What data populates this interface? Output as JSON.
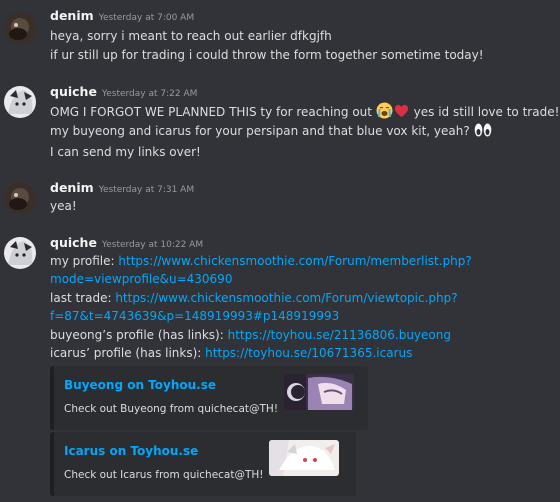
{
  "messages": [
    {
      "author": "denim",
      "timestamp": "Yesterday at 7:00 AM",
      "lines": [
        "heya, sorry i meant to reach out earlier dfkgjfh",
        "if ur still up for trading i could throw the form together sometime today!"
      ]
    },
    {
      "author": "quiche",
      "timestamp": "Yesterday at 7:22 AM",
      "line1_a": "OMG I FORGOT WE PLANNED THIS ty for reaching out",
      "line1_b": "yes id still love to trade!!",
      "line2": "my buyeong and icarus for your persipan and that blue vox kit, yeah?",
      "line3": "I can send my links over!",
      "emojis": [
        "loudly-crying-face",
        "red-heart",
        "eyes"
      ]
    },
    {
      "author": "denim",
      "timestamp": "Yesterday at 7:31 AM",
      "lines": [
        "yea!"
      ]
    },
    {
      "author": "quiche",
      "timestamp": "Yesterday at 10:22 AM",
      "profile_label": "my profile:",
      "profile_link_1": "https://www.chickensmoothie.com/Forum/memberlist.php?",
      "profile_link_2": "mode=viewprofile&u=430690",
      "trade_label": "last trade:",
      "trade_link_1": "https://www.chickensmoothie.com/Forum/viewtopic.php?",
      "trade_link_2": "f=87&t=4743639&p=148919993#p148919993",
      "buyeong_label": "buyeong’s profile (has links):",
      "buyeong_link": "https://toyhou.se/21136806.buyeong",
      "icarus_label": "icarus’ profile (has links):",
      "icarus_link": "https://toyhou.se/10671365.icarus",
      "embeds": [
        {
          "title": "Buyeong on Toyhou.se",
          "description": "Check out Buyeong from quichecat@TH!"
        },
        {
          "title": "Icarus on Toyhou.se",
          "description": "Check out Icarus from quichecat@TH!"
        }
      ]
    }
  ],
  "colors": {
    "background": "#313338",
    "link": "#00a8fc",
    "embed_background": "#2b2d31",
    "timestamp": "#949ba4"
  }
}
